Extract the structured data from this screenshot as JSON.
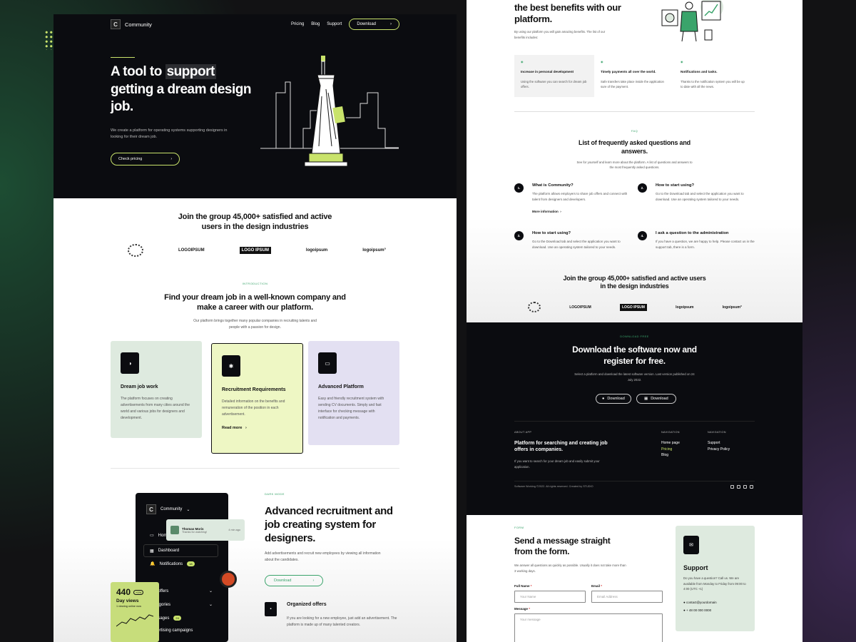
{
  "left": {
    "nav": {
      "logo_letter": "C",
      "brand": "Community",
      "links": [
        "Pricing",
        "Blog",
        "Support"
      ],
      "download": "Download"
    },
    "hero": {
      "title_a": "A tool to ",
      "title_hl": "support",
      "title_b": "getting a dream design job.",
      "desc": "We create a platform for operating systems supporting designers in looking for their dream job.",
      "cta": "Check pricing"
    },
    "join": {
      "title": "Join the group 45,000+ satisfied and active users in the design industries",
      "logos": [
        "LOGOIPSUM",
        "LOGO IPSUM",
        "logoipsum",
        "logoipsum°"
      ]
    },
    "intro": {
      "caption": "INTRODUCTION",
      "title": "Find your dream job in a well-known company and make a career with our platform.",
      "desc": "Our platform brings together many popular companies in recruiting talents and people with a passion for design."
    },
    "cards": [
      {
        "icon": "◑",
        "title": "Dream job work",
        "desc": "The platform focuses on creating advertisements from many cities around the world and various jobs for designers and development.",
        "bg": "#deeadf"
      },
      {
        "icon": "✱",
        "title": "Recruitment Requirements",
        "desc": "Detailed information on the benefits and remuneration of the position in each advertisement.",
        "link": "Read more",
        "bg": "#eef7c4"
      },
      {
        "icon": "▭",
        "title": "Advanced Platform",
        "desc": "Easy and friendly recruitment system with sending CV documents. Simply and fast interface for checking message with notification and payments.",
        "bg": "#e3e0f2"
      }
    ],
    "app": {
      "brand": "Community",
      "items": [
        "Home",
        "Dashboard",
        "Notifications",
        "Job offers",
        "Categories",
        "Messages",
        "Advertising campaigns"
      ],
      "notif_badge": "18",
      "msg_badge": "24",
      "toast_name": "Thomas Moris",
      "toast_msg": "Thanks for watching!",
      "toast_time": "4 min ago",
      "stat_num": "440",
      "stat_pct": "+1%",
      "stat_title": "Day views",
      "stat_sub": "1 viewing online now"
    },
    "dark": {
      "caption": "DARK MODE",
      "title": "Advanced recruitment and job creating system for designers.",
      "desc": "Add advertisements and recruit new employees by viewing all information about the candidates.",
      "btn": "Download",
      "feat_title": "Organized offers",
      "feat_desc": "If you are looking for a new employee, just add an advertisement. The platform is made up of many talented creators."
    }
  },
  "right": {
    "benefits": {
      "title": "the best benefits with our platform.",
      "desc": "By using our platform you will gain amazing benefits. The list of our benefits includes:",
      "items": [
        {
          "t": "Increase in personal development",
          "d": "Using the software you can search for dream job offers."
        },
        {
          "t": "Timely payments all over the world.",
          "d": "Safe transfers take place inside the application sure of the payment."
        },
        {
          "t": "Notifications and tasks.",
          "d": "Thanks to the notification system you will be up to date with all the news."
        }
      ]
    },
    "faq": {
      "caption": "FAQ",
      "title": "List of frequently asked questions and answers.",
      "desc": "See for yourself and learn more about the platform. A list of questions and answers to the most frequently asked questions.",
      "more": "More information",
      "items": [
        {
          "n": "1.",
          "q": "What is Community?",
          "a": "The platform allows employers to share job offers and connect with talent from designers and developers."
        },
        {
          "n": "2.",
          "q": "How to start using?",
          "a": "Go to the Download tab and select the application you want to download. Use an operating system tailored to your needs."
        },
        {
          "n": "3.",
          "q": "How to start using?",
          "a": "Go to the Download tab and select the application you want to download. Use an operating system tailored to your needs."
        },
        {
          "n": "4.",
          "q": "I ask a question to the administration",
          "a": "If you have a question, we are happy to help. Please contact us in the support tab, there is a form."
        }
      ]
    },
    "join": {
      "title": "Join the group 45,000+ satisfied and active users in the design industries"
    },
    "download": {
      "caption": "DOWNLOAD FREE",
      "title": "Download the software now and register for free.",
      "desc": "Select a platform and download the latest software version. Last version published on 24 July 2022.",
      "btn1": "Download",
      "btn2": "Download"
    },
    "footer": {
      "about_h": "ABOUT APP",
      "about_t": "Platform for searching and creating job offers in companies.",
      "about_d": "If you want to search for your dream job and easily submit your application.",
      "nav1_h": "NAVIGATION",
      "nav1": [
        "Home page",
        "Pricing",
        "Blog"
      ],
      "nav2_h": "NAVIGATION",
      "nav2": [
        "Support",
        "Privacy Policy"
      ],
      "copy": "Software Working ©2022. All rights reserved. Created by STUDIO"
    },
    "form": {
      "caption": "FORM",
      "title": "Send a message straight from the form.",
      "desc": "We answer all questions as quickly as possible. Usually it does not take more than 3 working days.",
      "name_l": "Full Name",
      "name_p": "Your Name",
      "email_l": "Email",
      "email_p": "Email Address",
      "msg_l": "Message",
      "msg_p": "Your message"
    },
    "support": {
      "title": "Support",
      "desc": "Do you have a question? Call us. We are available from Monday to Friday from 09:00 to 4:00 (UTC +1)",
      "email": "contact@yourdomain",
      "phone": "+ 48 00 000 0000"
    }
  },
  "colors": {
    "accent": "#c9e36b",
    "dark": "#0b0c10",
    "green": "#3aa46b"
  }
}
